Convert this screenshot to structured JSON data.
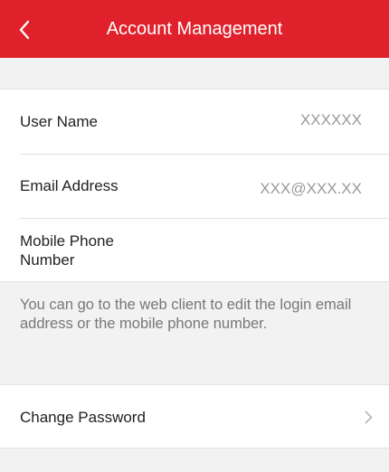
{
  "header": {
    "title": "Account Management",
    "back_icon": "chevron-left-icon",
    "bg_color": "#e0212b"
  },
  "account": {
    "rows": [
      {
        "label": "User Name",
        "value": "XXXXXX"
      },
      {
        "label": "Email Address",
        "value": "XXX@XXX.XX"
      },
      {
        "label": "Mobile Phone Number",
        "value": ""
      }
    ]
  },
  "notice": "You can go to the web client to edit the login email address or the mobile phone number.",
  "password": {
    "label": "Change Password",
    "chevron_icon": "chevron-right-icon"
  }
}
